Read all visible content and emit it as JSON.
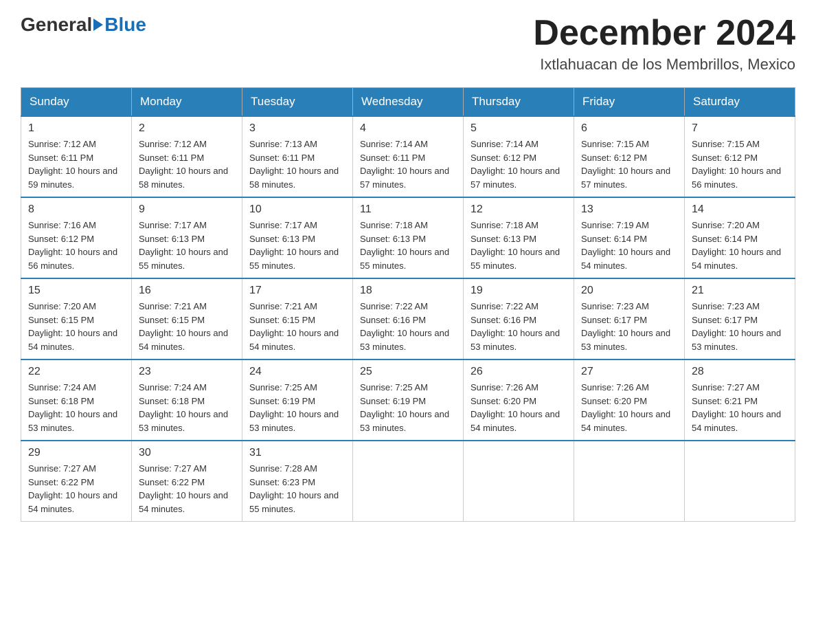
{
  "header": {
    "logo_general": "General",
    "logo_blue": "Blue",
    "month_title": "December 2024",
    "location": "Ixtlahuacan de los Membrillos, Mexico"
  },
  "days_of_week": [
    "Sunday",
    "Monday",
    "Tuesday",
    "Wednesday",
    "Thursday",
    "Friday",
    "Saturday"
  ],
  "weeks": [
    [
      {
        "num": "1",
        "sunrise": "7:12 AM",
        "sunset": "6:11 PM",
        "daylight": "10 hours and 59 minutes."
      },
      {
        "num": "2",
        "sunrise": "7:12 AM",
        "sunset": "6:11 PM",
        "daylight": "10 hours and 58 minutes."
      },
      {
        "num": "3",
        "sunrise": "7:13 AM",
        "sunset": "6:11 PM",
        "daylight": "10 hours and 58 minutes."
      },
      {
        "num": "4",
        "sunrise": "7:14 AM",
        "sunset": "6:11 PM",
        "daylight": "10 hours and 57 minutes."
      },
      {
        "num": "5",
        "sunrise": "7:14 AM",
        "sunset": "6:12 PM",
        "daylight": "10 hours and 57 minutes."
      },
      {
        "num": "6",
        "sunrise": "7:15 AM",
        "sunset": "6:12 PM",
        "daylight": "10 hours and 57 minutes."
      },
      {
        "num": "7",
        "sunrise": "7:15 AM",
        "sunset": "6:12 PM",
        "daylight": "10 hours and 56 minutes."
      }
    ],
    [
      {
        "num": "8",
        "sunrise": "7:16 AM",
        "sunset": "6:12 PM",
        "daylight": "10 hours and 56 minutes."
      },
      {
        "num": "9",
        "sunrise": "7:17 AM",
        "sunset": "6:13 PM",
        "daylight": "10 hours and 55 minutes."
      },
      {
        "num": "10",
        "sunrise": "7:17 AM",
        "sunset": "6:13 PM",
        "daylight": "10 hours and 55 minutes."
      },
      {
        "num": "11",
        "sunrise": "7:18 AM",
        "sunset": "6:13 PM",
        "daylight": "10 hours and 55 minutes."
      },
      {
        "num": "12",
        "sunrise": "7:18 AM",
        "sunset": "6:13 PM",
        "daylight": "10 hours and 55 minutes."
      },
      {
        "num": "13",
        "sunrise": "7:19 AM",
        "sunset": "6:14 PM",
        "daylight": "10 hours and 54 minutes."
      },
      {
        "num": "14",
        "sunrise": "7:20 AM",
        "sunset": "6:14 PM",
        "daylight": "10 hours and 54 minutes."
      }
    ],
    [
      {
        "num": "15",
        "sunrise": "7:20 AM",
        "sunset": "6:15 PM",
        "daylight": "10 hours and 54 minutes."
      },
      {
        "num": "16",
        "sunrise": "7:21 AM",
        "sunset": "6:15 PM",
        "daylight": "10 hours and 54 minutes."
      },
      {
        "num": "17",
        "sunrise": "7:21 AM",
        "sunset": "6:15 PM",
        "daylight": "10 hours and 54 minutes."
      },
      {
        "num": "18",
        "sunrise": "7:22 AM",
        "sunset": "6:16 PM",
        "daylight": "10 hours and 53 minutes."
      },
      {
        "num": "19",
        "sunrise": "7:22 AM",
        "sunset": "6:16 PM",
        "daylight": "10 hours and 53 minutes."
      },
      {
        "num": "20",
        "sunrise": "7:23 AM",
        "sunset": "6:17 PM",
        "daylight": "10 hours and 53 minutes."
      },
      {
        "num": "21",
        "sunrise": "7:23 AM",
        "sunset": "6:17 PM",
        "daylight": "10 hours and 53 minutes."
      }
    ],
    [
      {
        "num": "22",
        "sunrise": "7:24 AM",
        "sunset": "6:18 PM",
        "daylight": "10 hours and 53 minutes."
      },
      {
        "num": "23",
        "sunrise": "7:24 AM",
        "sunset": "6:18 PM",
        "daylight": "10 hours and 53 minutes."
      },
      {
        "num": "24",
        "sunrise": "7:25 AM",
        "sunset": "6:19 PM",
        "daylight": "10 hours and 53 minutes."
      },
      {
        "num": "25",
        "sunrise": "7:25 AM",
        "sunset": "6:19 PM",
        "daylight": "10 hours and 53 minutes."
      },
      {
        "num": "26",
        "sunrise": "7:26 AM",
        "sunset": "6:20 PM",
        "daylight": "10 hours and 54 minutes."
      },
      {
        "num": "27",
        "sunrise": "7:26 AM",
        "sunset": "6:20 PM",
        "daylight": "10 hours and 54 minutes."
      },
      {
        "num": "28",
        "sunrise": "7:27 AM",
        "sunset": "6:21 PM",
        "daylight": "10 hours and 54 minutes."
      }
    ],
    [
      {
        "num": "29",
        "sunrise": "7:27 AM",
        "sunset": "6:22 PM",
        "daylight": "10 hours and 54 minutes."
      },
      {
        "num": "30",
        "sunrise": "7:27 AM",
        "sunset": "6:22 PM",
        "daylight": "10 hours and 54 minutes."
      },
      {
        "num": "31",
        "sunrise": "7:28 AM",
        "sunset": "6:23 PM",
        "daylight": "10 hours and 55 minutes."
      },
      null,
      null,
      null,
      null
    ]
  ]
}
